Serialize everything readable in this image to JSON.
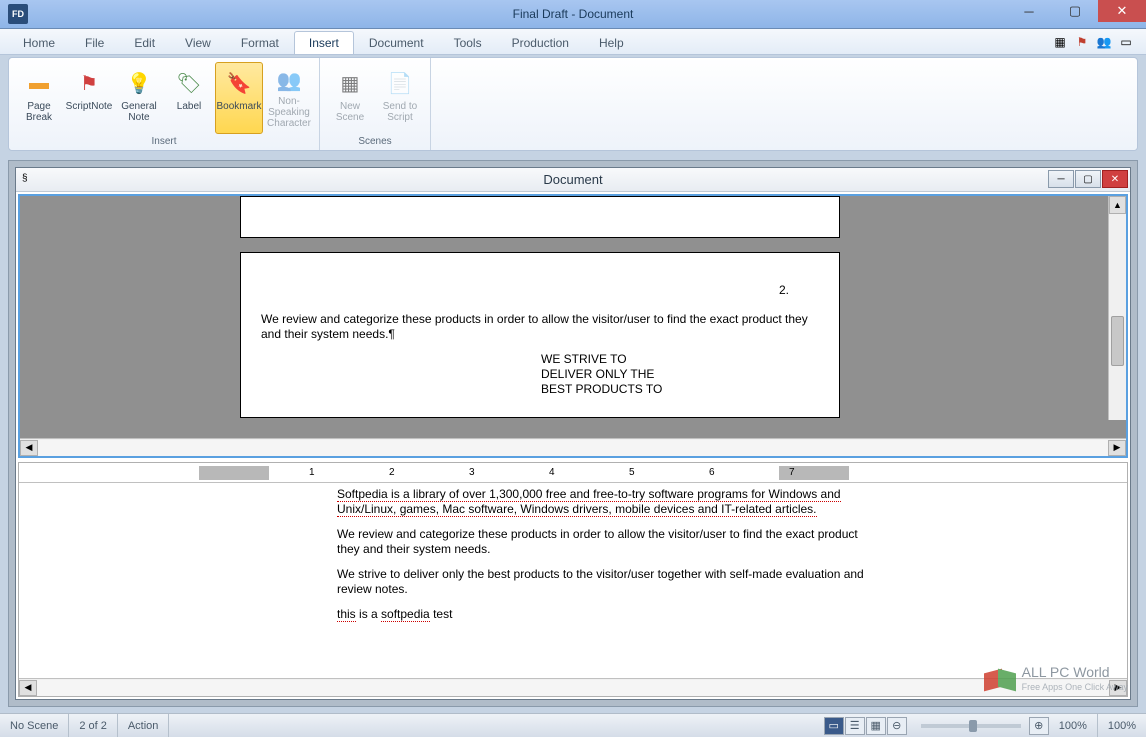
{
  "titlebar": {
    "title": "Final Draft - Document"
  },
  "menus": [
    "Home",
    "File",
    "Edit",
    "View",
    "Format",
    "Insert",
    "Document",
    "Tools",
    "Production",
    "Help"
  ],
  "active_menu": 5,
  "ribbon": {
    "groups": [
      {
        "label": "Insert",
        "items": [
          {
            "name": "page-break",
            "label": "Page\nBreak",
            "icon": "▭",
            "color": "#f0a030"
          },
          {
            "name": "scriptnote",
            "label": "ScriptNote",
            "icon": "⚑",
            "color": "#d04040"
          },
          {
            "name": "general-note",
            "label": "General\nNote",
            "icon": "💡",
            "color": "#f0c030"
          },
          {
            "name": "label",
            "label": "Label",
            "icon": "🏷",
            "color": "#4a8a4a"
          },
          {
            "name": "bookmark",
            "label": "Bookmark",
            "icon": "🔖",
            "color": "#c09020",
            "selected": true
          },
          {
            "name": "non-speaking-character",
            "label": "Non-Speaking\nCharacter",
            "icon": "👥",
            "color": "#b0b0b0",
            "disabled": true
          }
        ]
      },
      {
        "label": "Scenes",
        "items": [
          {
            "name": "new-scene",
            "label": "New\nScene",
            "icon": "▦",
            "color": "#b0b0b0",
            "disabled": true
          },
          {
            "name": "send-to-script",
            "label": "Send to\nScript",
            "icon": "📄",
            "color": "#b0b0b0",
            "disabled": true
          }
        ]
      }
    ]
  },
  "doc_window": {
    "title": "Document"
  },
  "page": {
    "number": "2.",
    "para1": "We review and categorize these products in order to allow the visitor/user to find the exact product they and their system needs.¶",
    "block": "WE STRIVE TO\nDELIVER ONLY THE\nBEST PRODUCTS TO"
  },
  "lower": {
    "p1": "Softpedia is a library of over 1,300,000 free and free-to-try software programs for Windows and Unix/Linux, games, Mac software, Windows drivers, mobile devices and IT-related articles.",
    "p2": "We review and categorize these products in order to allow the visitor/user to find the exact product they and their system needs.",
    "p3": "We strive to deliver only the best products to the visitor/user together with self-made evaluation and review notes.",
    "p4_a": "this",
    "p4_b": " is a ",
    "p4_c": "softpedia",
    "p4_d": " test"
  },
  "ruler_nums": [
    "1",
    "2",
    "3",
    "4",
    "5",
    "6",
    "7"
  ],
  "status": {
    "scene": "No Scene",
    "page": "2  of  2",
    "element": "Action",
    "zoom1": "100%",
    "zoom2": "100%"
  },
  "watermark": {
    "title": "ALL PC World",
    "sub": "Free Apps One Click Away"
  }
}
